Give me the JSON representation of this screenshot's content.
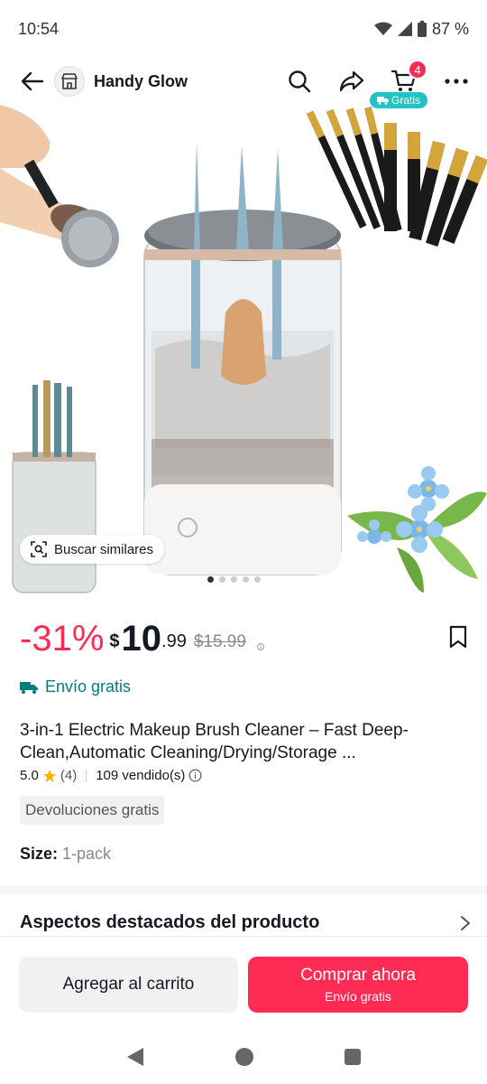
{
  "status_bar": {
    "time": "10:54",
    "battery": "87 %"
  },
  "header": {
    "shop_name": "Handy Glow",
    "cart_count": "4",
    "cart_badge_label": "Gratis"
  },
  "gallery": {
    "search_similar_label": "Buscar similares",
    "slide_count": 5,
    "active_slide": 0
  },
  "pricing": {
    "discount": "-31%",
    "currency": "$",
    "price_int": "10",
    "price_dec": ".99",
    "original_price": "$15.99"
  },
  "shipping": {
    "label": "Envío gratis"
  },
  "product": {
    "title": "3-in-1 Electric Makeup Brush Cleaner – Fast Deep-Clean,Automatic Cleaning/Drying/Storage ...",
    "rating": "5.0",
    "rating_count": "(4)",
    "sold": "109 vendido(s)",
    "returns_badge": "Devoluciones gratis",
    "size_label": "Size:",
    "size_value": "1-pack"
  },
  "highlights": {
    "label": "Aspectos destacados del producto"
  },
  "actions": {
    "add_to_cart": "Agregar al carrito",
    "buy_now": "Comprar ahora",
    "buy_now_sub": "Envío gratis"
  },
  "colors": {
    "accent": "#fe2c55",
    "teal": "#007d7d",
    "badge_teal": "#20c4c4"
  }
}
